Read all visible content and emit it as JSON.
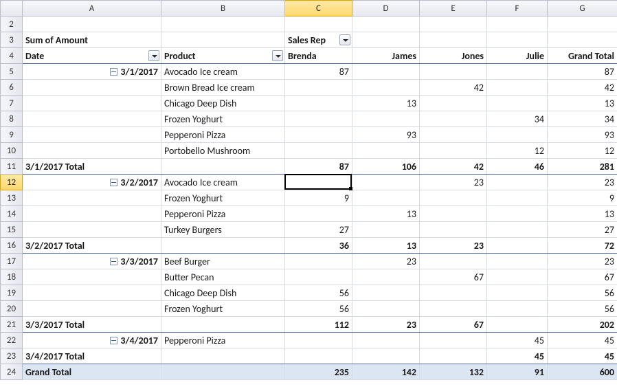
{
  "columns": [
    "A",
    "B",
    "C",
    "D",
    "E",
    "F",
    "G"
  ],
  "rows_start": 2,
  "rows_end": 24,
  "active_col": "C",
  "active_row": 12,
  "pivot": {
    "measure_label": "Sum of Amount",
    "col_field": "Sales Rep",
    "row_field_1": "Date",
    "row_field_2": "Product",
    "col_headers": [
      "Brenda",
      "James",
      "Jones",
      "Julie",
      "Grand Total"
    ],
    "groups": [
      {
        "date": "3/1/2017",
        "rows": [
          {
            "product": "Avocado Ice cream",
            "v": [
              "87",
              "",
              "",
              "",
              "87"
            ]
          },
          {
            "product": "Brown Bread Ice cream",
            "v": [
              "",
              "",
              "42",
              "",
              "42"
            ]
          },
          {
            "product": "Chicago Deep Dish",
            "v": [
              "",
              "13",
              "",
              "",
              "13"
            ]
          },
          {
            "product": "Frozen Yoghurt",
            "v": [
              "",
              "",
              "",
              "34",
              "34"
            ]
          },
          {
            "product": "Pepperoni Pizza",
            "v": [
              "",
              "93",
              "",
              "",
              "93"
            ]
          },
          {
            "product": "Portobello Mushroom",
            "v": [
              "",
              "",
              "",
              "12",
              "12"
            ]
          }
        ],
        "total_label": "3/1/2017 Total",
        "total": [
          "87",
          "106",
          "42",
          "46",
          "281"
        ]
      },
      {
        "date": "3/2/2017",
        "rows": [
          {
            "product": "Avocado Ice cream",
            "v": [
              "",
              "",
              "23",
              "",
              "23"
            ]
          },
          {
            "product": "Frozen Yoghurt",
            "v": [
              "9",
              "",
              "",
              "",
              "9"
            ]
          },
          {
            "product": "Pepperoni Pizza",
            "v": [
              "",
              "13",
              "",
              "",
              "13"
            ]
          },
          {
            "product": "Turkey Burgers",
            "v": [
              "27",
              "",
              "",
              "",
              "27"
            ]
          }
        ],
        "total_label": "3/2/2017 Total",
        "total": [
          "36",
          "13",
          "23",
          "",
          "72"
        ]
      },
      {
        "date": "3/3/2017",
        "rows": [
          {
            "product": "Beef Burger",
            "v": [
              "",
              "23",
              "",
              "",
              "23"
            ]
          },
          {
            "product": "Butter Pecan",
            "v": [
              "",
              "",
              "67",
              "",
              "67"
            ]
          },
          {
            "product": "Chicago Deep Dish",
            "v": [
              "56",
              "",
              "",
              "",
              "56"
            ]
          },
          {
            "product": "Frozen Yoghurt",
            "v": [
              "56",
              "",
              "",
              "",
              "56"
            ]
          }
        ],
        "total_label": "3/3/2017 Total",
        "total": [
          "112",
          "23",
          "67",
          "",
          "202"
        ]
      },
      {
        "date": "3/4/2017",
        "rows": [
          {
            "product": "Pepperoni Pizza",
            "v": [
              "",
              "",
              "",
              "45",
              "45"
            ]
          }
        ],
        "total_label": "3/4/2017 Total",
        "total": [
          "",
          "",
          "",
          "45",
          "45"
        ]
      }
    ],
    "grand_label": "Grand Total",
    "grand": [
      "235",
      "142",
      "132",
      "91",
      "600"
    ]
  }
}
